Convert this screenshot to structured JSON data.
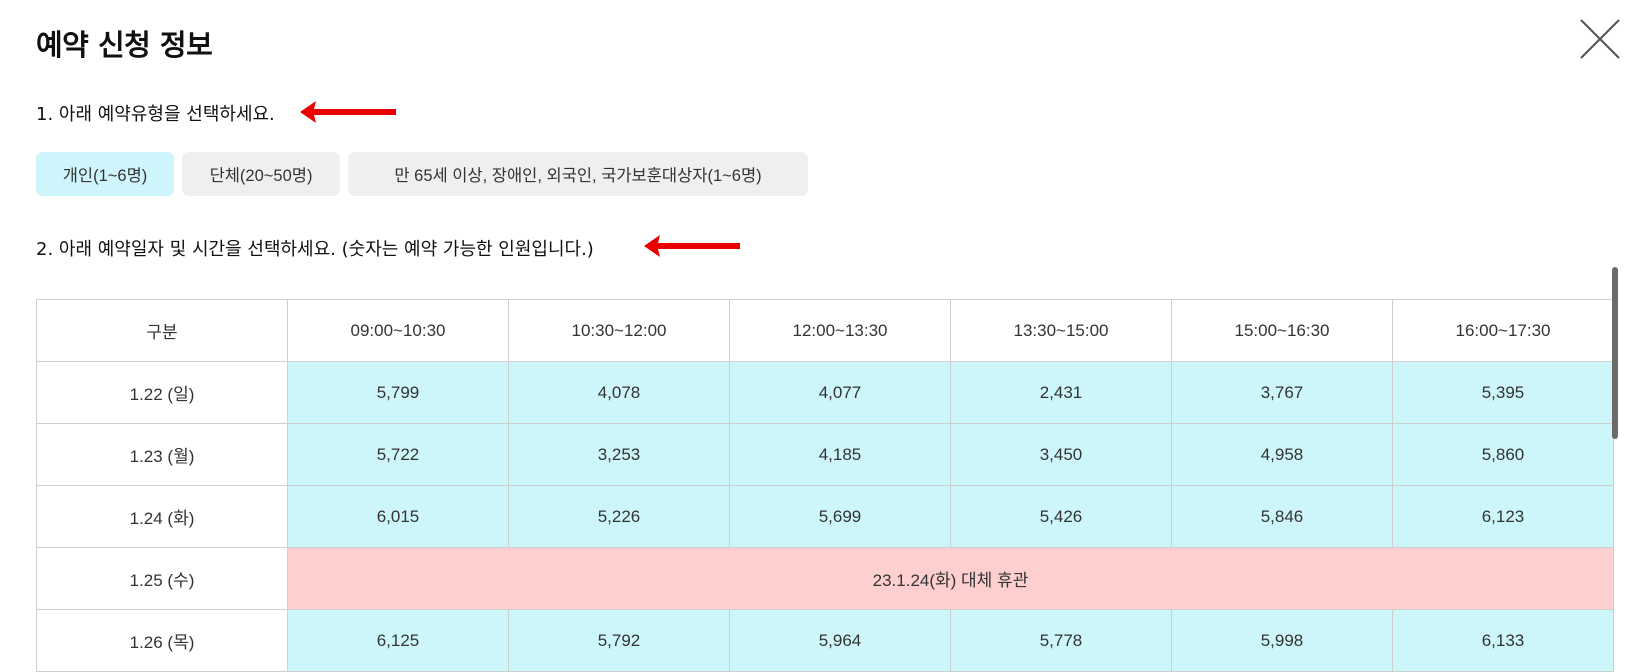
{
  "modal": {
    "title": "예약 신청 정보"
  },
  "steps": {
    "step1": "1. 아래 예약유형을 선택하세요.",
    "step2": "2. 아래 예약일자 및 시간을 선택하세요. (숫자는 예약 가능한 인원입니다.)"
  },
  "reservation_types": [
    {
      "label": "개인(1~6명)",
      "selected": true
    },
    {
      "label": "단체(20~50명)",
      "selected": false
    },
    {
      "label": "만 65세 이상, 장애인, 외국인, 국가보훈대상자(1~6명)",
      "selected": false
    }
  ],
  "table": {
    "headers": [
      "구분",
      "09:00~10:30",
      "10:30~12:00",
      "12:00~13:30",
      "13:30~15:00",
      "15:00~16:30",
      "16:00~17:30"
    ],
    "rows": [
      {
        "date": "1.22 (일)",
        "cells": [
          "5,799",
          "4,078",
          "4,077",
          "2,431",
          "3,767",
          "5,395"
        ]
      },
      {
        "date": "1.23 (월)",
        "cells": [
          "5,722",
          "3,253",
          "4,185",
          "3,450",
          "4,958",
          "5,860"
        ]
      },
      {
        "date": "1.24 (화)",
        "cells": [
          "6,015",
          "5,226",
          "5,699",
          "5,426",
          "5,846",
          "6,123"
        ]
      },
      {
        "date": "1.25 (수)",
        "closed_text": "23.1.24(화) 대체 휴관"
      },
      {
        "date": "1.26 (목)",
        "cells": [
          "6,125",
          "5,792",
          "5,964",
          "5,778",
          "5,998",
          "6,133"
        ]
      }
    ]
  },
  "colors": {
    "available": "#cdf6fb",
    "closed": "#fecfcf",
    "selected_type": "#cdf5fb",
    "arrow": "#e80000"
  },
  "icons": {
    "close": "close-icon",
    "pointer": "red-arrow-icon"
  }
}
